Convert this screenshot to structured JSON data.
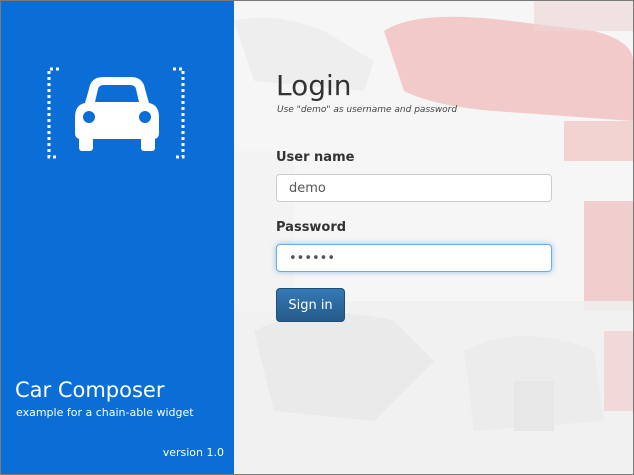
{
  "brand": {
    "logo_icon": "car-in-brackets-icon",
    "title": "Car Composer",
    "subtitle": "example for a chain-able widget",
    "version": "version 1.0"
  },
  "login": {
    "title": "Login",
    "hint": "Use \"demo\" as username and password",
    "username_label": "User name",
    "username_value": "demo",
    "password_label": "Password",
    "password_value": "demo12",
    "sign_in_label": "Sign in"
  },
  "colors": {
    "brand_blue": "#0a6ed6",
    "button_blue": "#2e6da4",
    "focus_ring": "#66afe9"
  }
}
